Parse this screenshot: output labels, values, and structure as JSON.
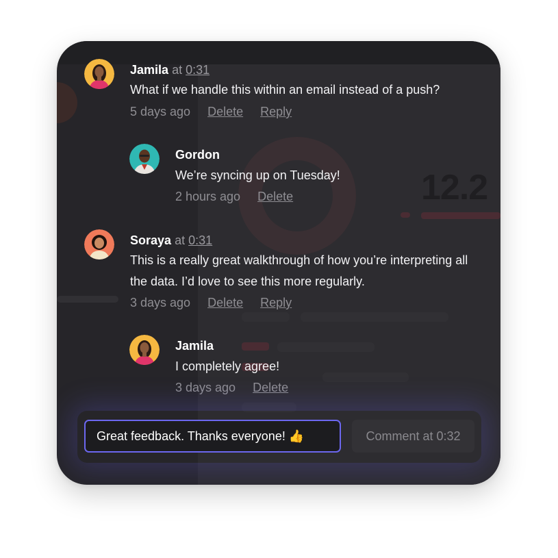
{
  "comments": [
    {
      "author": "Jamila",
      "at_label": "at",
      "timestamp": "0:31",
      "lines": [
        "What if we handle this within an email instead of a push?"
      ],
      "age": "5 days ago",
      "delete_label": "Delete",
      "reply_label": "Reply"
    },
    {
      "author": "Gordon",
      "lines": [
        "We’re syncing up on Tuesday!"
      ],
      "age": "2 hours ago",
      "delete_label": "Delete"
    },
    {
      "author": "Soraya",
      "at_label": "at",
      "timestamp": "0:31",
      "lines": [
        "This is a really great walkthrough of how you’re interpreting all",
        "the data. I’d love to see this more regularly."
      ],
      "age": "3 days ago",
      "delete_label": "Delete",
      "reply_label": "Reply"
    },
    {
      "author": "Jamila",
      "lines": [
        "I completely agree!"
      ],
      "age": "3 days ago",
      "delete_label": "Delete"
    }
  ],
  "composer": {
    "value": "Great feedback. Thanks everyone! 👍",
    "submit_label": "Comment at 0:32"
  },
  "background": {
    "metric": "12.2"
  },
  "colors": {
    "accent": "#6c67f0",
    "card_bg": "#262529",
    "avatar_jamila": "#f5b841",
    "avatar_gordon": "#2fb8b3",
    "avatar_soraya": "#f07a5a"
  }
}
